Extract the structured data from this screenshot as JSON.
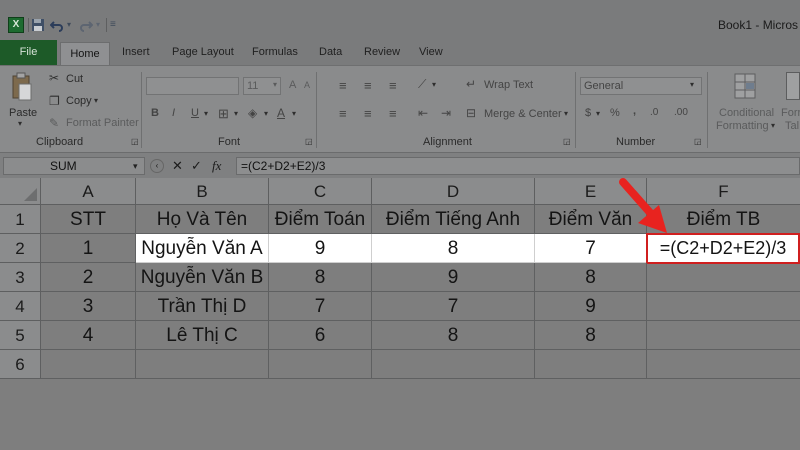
{
  "window": {
    "title": "Book1 - Micros"
  },
  "tabs": {
    "file": "File",
    "home": "Home",
    "insert": "Insert",
    "page_layout": "Page Layout",
    "formulas": "Formulas",
    "data": "Data",
    "review": "Review",
    "view": "View"
  },
  "ribbon": {
    "clipboard": {
      "paste": "Paste",
      "cut": "Cut",
      "copy": "Copy",
      "format_painter": "Format Painter",
      "label": "Clipboard"
    },
    "font": {
      "size": "11",
      "bold": "B",
      "italic": "I",
      "underline": "U",
      "label": "Font"
    },
    "alignment": {
      "wrap_text": "Wrap Text",
      "merge_center": "Merge & Center",
      "label": "Alignment"
    },
    "number": {
      "format": "General",
      "dollar": "$",
      "percent": "%",
      "comma": ",",
      "label": "Number"
    },
    "styles": {
      "conditional_1": "Conditional",
      "conditional_2": "Formatting",
      "format_as_1": "Forr",
      "format_as_2": "Tal"
    }
  },
  "formula_bar": {
    "name_box": "SUM",
    "formula": "=(C2+D2+E2)/3"
  },
  "sheet": {
    "columns": [
      "A",
      "B",
      "C",
      "D",
      "E",
      "F"
    ],
    "rows": [
      "1",
      "2",
      "3",
      "4",
      "5",
      "6"
    ],
    "header_row": [
      "STT",
      "Họ Và Tên",
      "Điểm Toán",
      "Điểm Tiếng Anh",
      "Điểm Văn",
      "Điểm TB"
    ],
    "data": [
      [
        "1",
        "Nguyễn Văn A",
        "9",
        "8",
        "7",
        "=(C2+D2+E2)/3"
      ],
      [
        "2",
        "Nguyễn Văn B",
        "8",
        "9",
        "8",
        ""
      ],
      [
        "3",
        "Trần Thị D",
        "7",
        "7",
        "9",
        ""
      ],
      [
        "4",
        "Lê Thị C",
        "6",
        "8",
        "8",
        ""
      ]
    ]
  },
  "colors": {
    "active_border": "#d01f1f",
    "arrow": "#e8231f",
    "file_tab": "#1d5a28"
  }
}
